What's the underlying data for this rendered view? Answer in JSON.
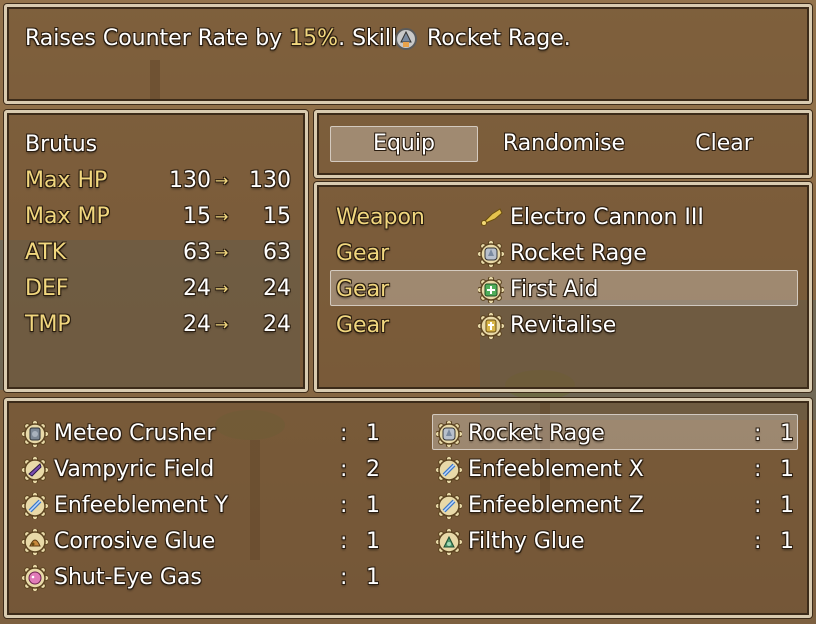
{
  "help": {
    "prefix": "Raises Counter Rate by ",
    "highlight": "15%",
    "middle": ". Skill: ",
    "skill": "Rocket Rage",
    "suffix": ".",
    "skill_icon": "rocket-skill-icon"
  },
  "status": {
    "actor": "Brutus",
    "rows": [
      {
        "label": "Max HP",
        "current": "130",
        "arrow": "→",
        "new": "130"
      },
      {
        "label": "Max MP",
        "current": "15",
        "arrow": "→",
        "new": "15"
      },
      {
        "label": "ATK",
        "current": "63",
        "arrow": "→",
        "new": "63"
      },
      {
        "label": "DEF",
        "current": "24",
        "arrow": "→",
        "new": "24"
      },
      {
        "label": "TMP",
        "current": "24",
        "arrow": "→",
        "new": "24"
      }
    ]
  },
  "commands": {
    "equip": "Equip",
    "randomise": "Randomise",
    "clear": "Clear",
    "selected": "Equip"
  },
  "slots": [
    {
      "type": "Weapon",
      "item": "Electro Cannon III",
      "icon": "trumpet-weapon-icon"
    },
    {
      "type": "Gear",
      "item": "Rocket Rage",
      "icon": "gear-rocket-icon"
    },
    {
      "type": "Gear",
      "item": "First Aid",
      "icon": "gear-first-aid-icon"
    },
    {
      "type": "Gear",
      "item": "Revitalise",
      "icon": "gear-revitalise-icon"
    }
  ],
  "selected_slot": 2,
  "items": {
    "separator": ":",
    "left": [
      {
        "name": "Meteo Crusher",
        "count": "1",
        "icon": "gear-meteo-icon"
      },
      {
        "name": "Vampyric Field",
        "count": "2",
        "icon": "gear-vampyric-icon"
      },
      {
        "name": "Enfeeblement Y",
        "count": "1",
        "icon": "gear-enfeeble-icon"
      },
      {
        "name": "Corrosive Glue",
        "count": "1",
        "icon": "gear-corrosive-icon"
      },
      {
        "name": "Shut-Eye Gas",
        "count": "1",
        "icon": "gear-sleep-icon"
      }
    ],
    "right": [
      {
        "name": "Rocket Rage",
        "count": "1",
        "icon": "gear-rocket-icon"
      },
      {
        "name": "Enfeeblement X",
        "count": "1",
        "icon": "gear-enfeeble-icon"
      },
      {
        "name": "Enfeeblement Z",
        "count": "1",
        "icon": "gear-enfeeble-icon"
      },
      {
        "name": "Filthy Glue",
        "count": "1",
        "icon": "gear-glue-icon"
      }
    ],
    "selected": "Rocket Rage"
  },
  "colors": {
    "system_text": "#f1d77f",
    "normal_text": "#ffffff",
    "window_border": "#d9cbb0"
  }
}
